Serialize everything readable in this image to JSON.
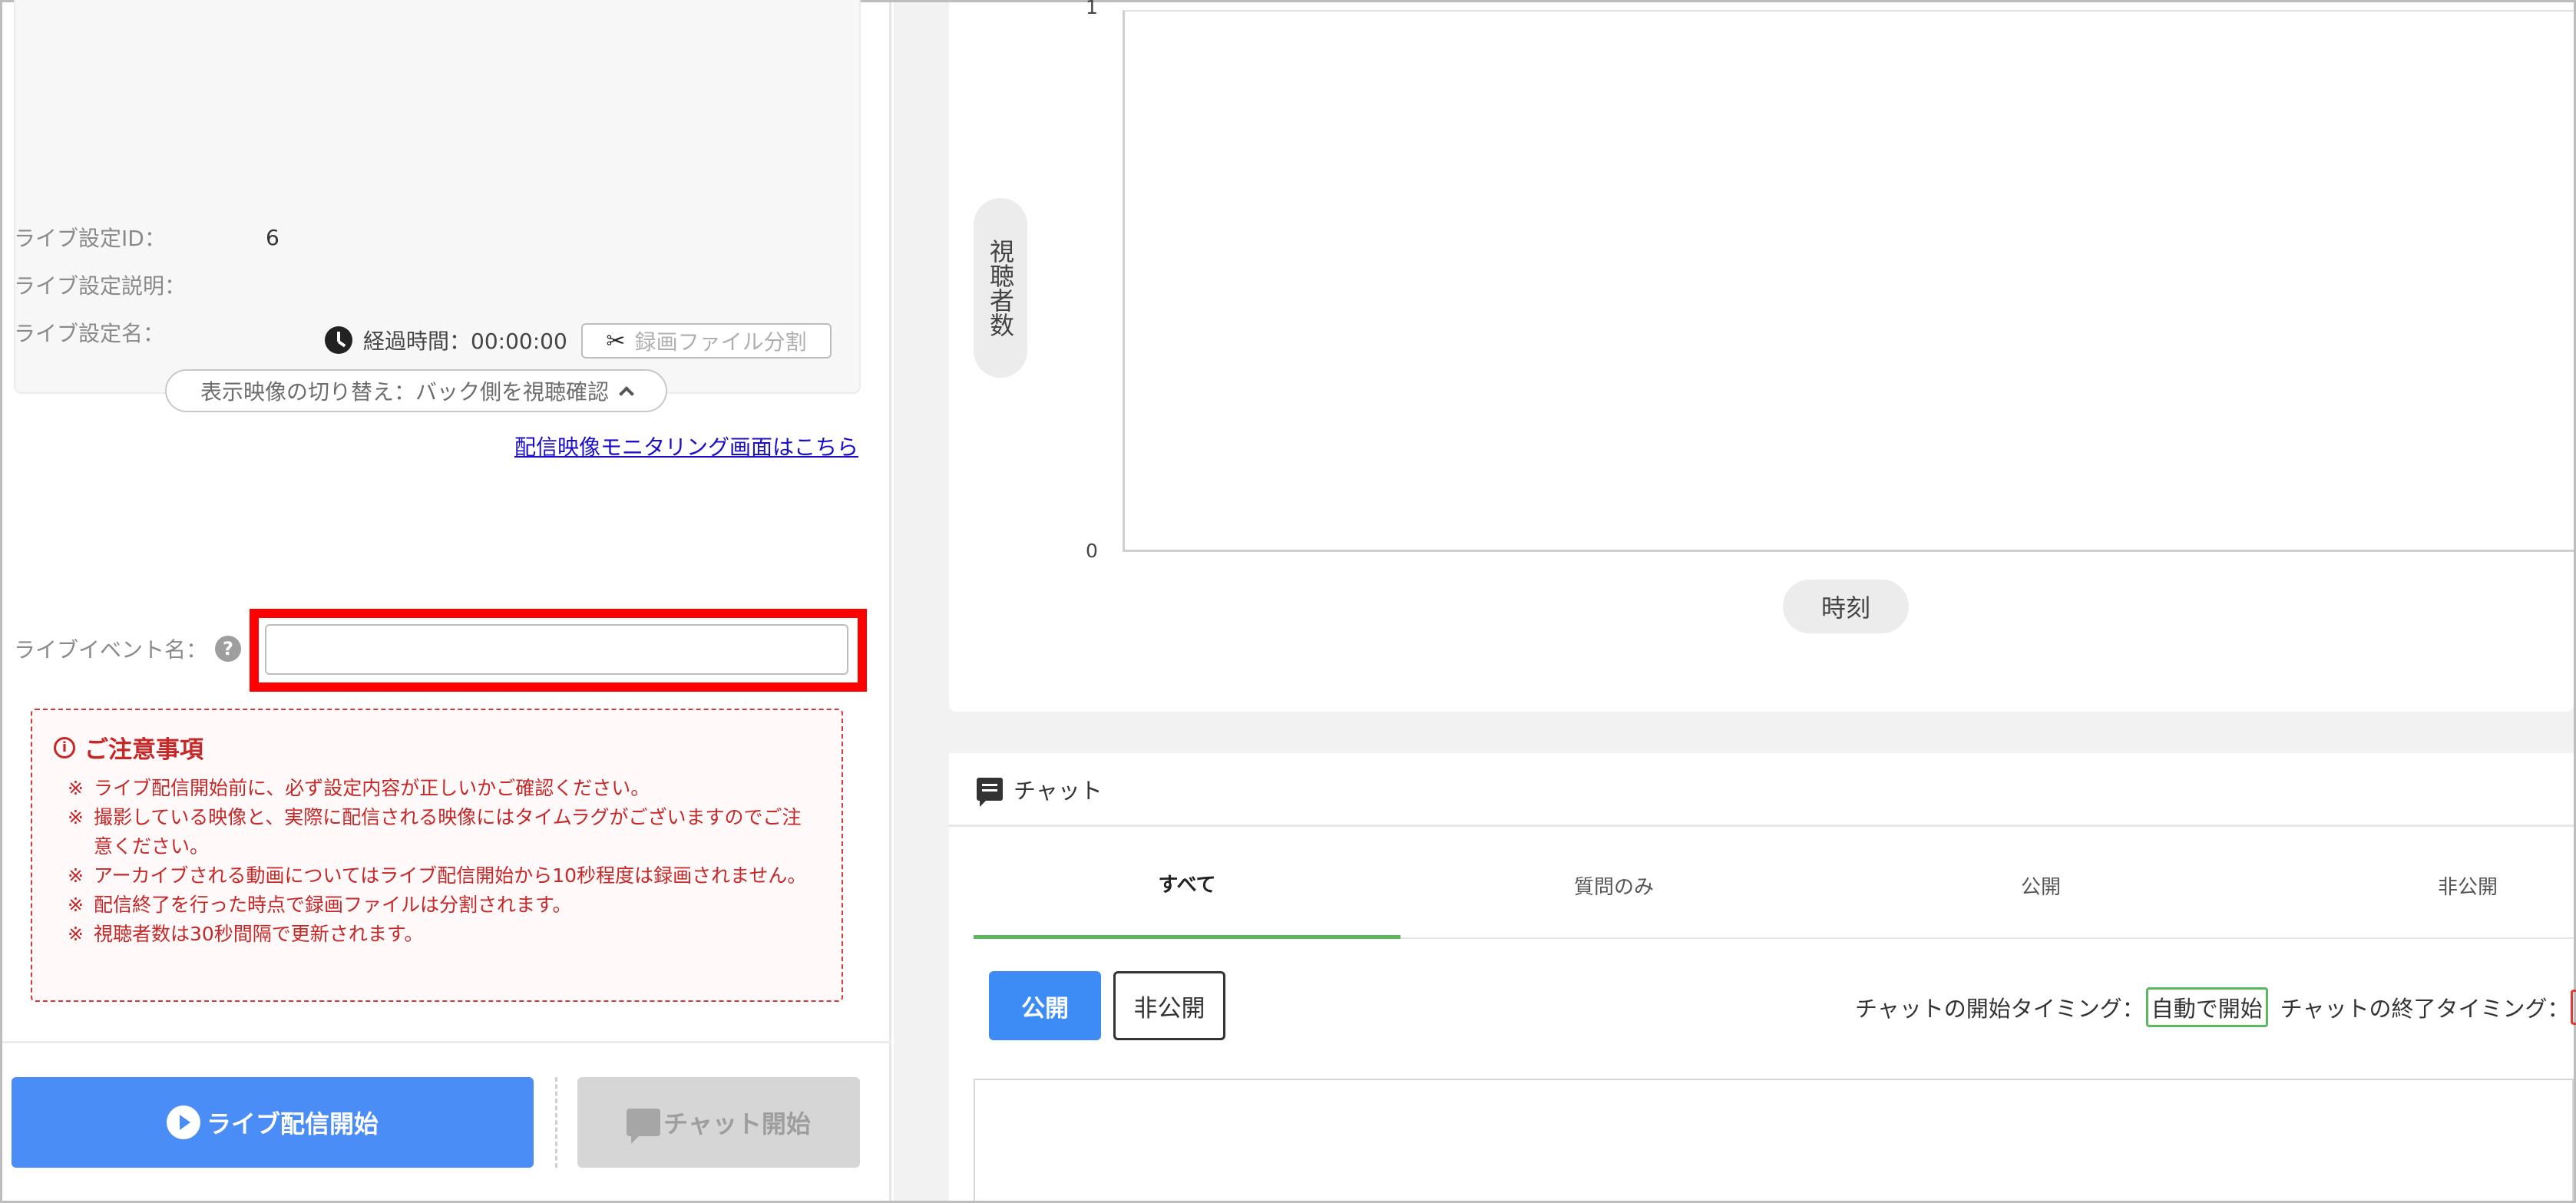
{
  "player": {
    "elapsed": "経過時間：00:00:00",
    "split_button": "録画ファイル分割",
    "switch_view": "表示映像の切り替え：バック側を視聴確認"
  },
  "monitor_link": "配信映像モニタリング画面はこちら",
  "fields": {
    "setting_id_label": "ライブ設定ID：",
    "setting_id_value": "6",
    "setting_desc_label": "ライブ設定説明：",
    "setting_name_label": "ライブ設定名：",
    "event_name_label": "ライブイベント名：",
    "event_name_value": ""
  },
  "notice": {
    "title": "ご注意事項",
    "items": [
      {
        "mark": "※",
        "text": "ライブ配信開始前に、必ず設定内容が正しいかご確認ください。"
      },
      {
        "mark": "※",
        "text": "撮影している映像と、実際に配信される映像にはタイムラグがございますのでご注意ください。"
      },
      {
        "mark": "※",
        "text": "アーカイブされる動画についてはライブ配信開始から10秒程度は録画されません。"
      },
      {
        "mark": "※",
        "text": "配信終了を行った時点で録画ファイルは分割されます。"
      },
      {
        "mark": "※",
        "text": "視聴者数は30秒間隔で更新されます。"
      }
    ]
  },
  "buttons": {
    "live_start": "ライブ配信開始",
    "chat_start": "チャット開始"
  },
  "chart_data": {
    "type": "line",
    "title": "",
    "xlabel": "時刻",
    "ylabel": "視聴者数",
    "ylim": [
      0,
      1
    ],
    "y_ticks": [
      "1",
      "0"
    ],
    "x": [],
    "series": []
  },
  "chat": {
    "header": "チャット",
    "tabs": [
      "すべて",
      "質問のみ",
      "公開",
      "非公開"
    ],
    "active_tab": "すべて",
    "publish_button": "公開",
    "unpublish_button": "非公開",
    "start_timing_label": "チャットの開始タイミング：",
    "start_timing_value": "自動で開始",
    "end_timing_label": "チャットの終了タイミング："
  },
  "colors": {
    "primary_blue": "#4a8df6",
    "highlight_red": "#ff0000",
    "notice_red": "#c62828",
    "tab_active_green": "#5cb85c"
  }
}
